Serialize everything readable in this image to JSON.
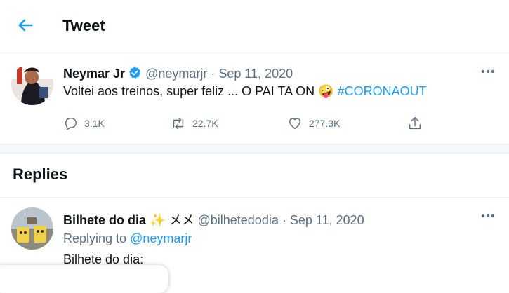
{
  "header": {
    "back_icon": "arrow-left-icon",
    "title": "Tweet"
  },
  "tweet": {
    "author_name": "Neymar Jr",
    "verified_icon": "verified-badge-icon",
    "handle": "@neymarjr",
    "separator": " · ",
    "date": "Sep 11, 2020",
    "text": "Voltei aos treinos, super feliz ... O PAI TA ON",
    "emoji": "🤪",
    "hashtag": "#CORONAOUT",
    "replies": "3.1K",
    "retweets": "22.7K",
    "likes": "277.3K",
    "colors": {
      "accent": "#1d9bf0",
      "muted": "#5b7083",
      "verified": "#1d9bf0"
    }
  },
  "replies_section": {
    "heading": "Replies"
  },
  "reply": {
    "author_name": "Bilhete do dia",
    "sparkle_emoji": "✨",
    "extra_glyph": "メメ",
    "handle": "@bilhetedodia",
    "separator": " · ",
    "date": "Sep 11, 2020",
    "replying_to_label": "Replying to",
    "replying_to_handle": "@neymarjr",
    "text": "Bilhete do dia:"
  }
}
